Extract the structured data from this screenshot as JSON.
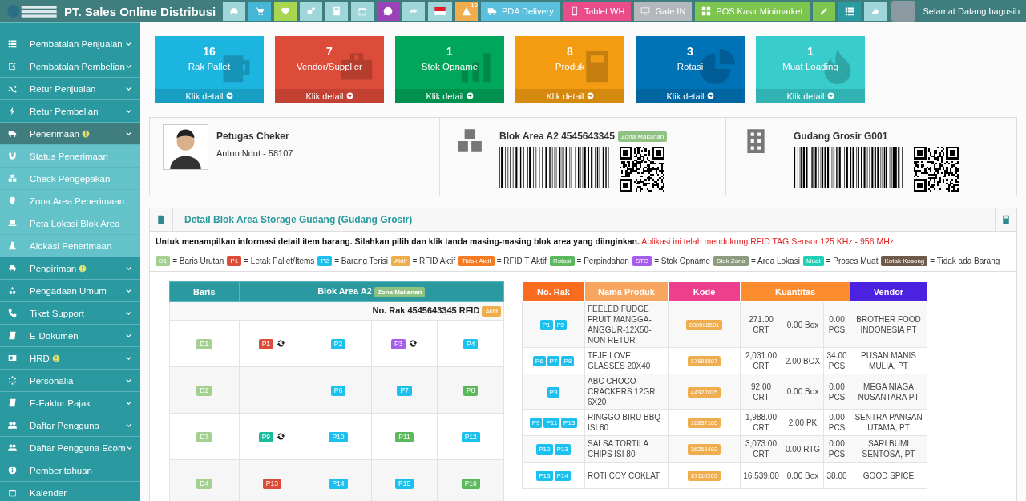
{
  "header": {
    "title": "PT. Sales Online Distribusi",
    "icon_buttons": [
      {
        "color": "#9fd6da"
      },
      {
        "color": "#45b6d6"
      },
      {
        "color": "#a9d651"
      },
      {
        "color": "#9fd6da"
      },
      {
        "color": "#9fd6da"
      },
      {
        "color": "#9fd6da"
      },
      {
        "color": "#9b42b8"
      },
      {
        "color": "#9fd6da"
      },
      {
        "color": "#9fd6da"
      },
      {
        "color": "#f0ad4e",
        "badge": "10"
      }
    ],
    "text_buttons": [
      {
        "label": "PDA Delivery",
        "color": "#5bc0de"
      },
      {
        "label": "Tablet WH",
        "color": "#ea4c89"
      },
      {
        "label": "Gate IN",
        "color": "#b3b8bc"
      },
      {
        "label": "POS Kasir Minimarket",
        "color": "#7cc54f"
      }
    ],
    "tool_buttons": [
      {
        "color": "#7cc54f"
      },
      {
        "color": "#2a9aa0"
      },
      {
        "color": "#9fd6da"
      }
    ],
    "greeting": "Selamat Datang bagusib"
  },
  "sidebar": {
    "items": [
      {
        "label": "Pembatalan Penjualan",
        "alert": false,
        "expandable": true,
        "selected": false
      },
      {
        "label": "Pembatalan Pembelian",
        "alert": false,
        "expandable": true,
        "selected": false
      },
      {
        "label": "Retur Penjualan",
        "alert": false,
        "expandable": true,
        "selected": false
      },
      {
        "label": "Retur Pembelian",
        "alert": false,
        "expandable": true,
        "selected": false
      },
      {
        "label": "Penerimaan",
        "alert": true,
        "expandable": true,
        "selected": true,
        "children": [
          {
            "label": "Status Penerimaan"
          },
          {
            "label": "Check Pengepakan"
          },
          {
            "label": "Zona Area Penerimaan"
          },
          {
            "label": "Peta Lokasi Blok Area"
          },
          {
            "label": "Alokasi Penerimaan"
          }
        ]
      },
      {
        "label": "Pengiriman",
        "alert": true,
        "expandable": true,
        "selected": false
      },
      {
        "label": "Pengadaan Umum",
        "alert": false,
        "expandable": true,
        "selected": false
      },
      {
        "label": "Tiket Support",
        "alert": false,
        "expandable": true,
        "selected": false
      },
      {
        "label": "E-Dokumen",
        "alert": false,
        "expandable": true,
        "selected": false
      },
      {
        "label": "HRD",
        "alert": true,
        "expandable": true,
        "selected": false
      },
      {
        "label": "Personalia",
        "alert": false,
        "expandable": true,
        "selected": false
      },
      {
        "label": "E-Faktur Pajak",
        "alert": false,
        "expandable": true,
        "selected": false
      },
      {
        "label": "Daftar Pengguna",
        "alert": false,
        "expandable": true,
        "selected": false
      },
      {
        "label": "Daftar Pengguna Ecom",
        "alert": false,
        "expandable": true,
        "selected": false
      },
      {
        "label": "Pemberitahuan",
        "alert": false,
        "expandable": false,
        "selected": false
      },
      {
        "label": "Kalender",
        "alert": false,
        "expandable": false,
        "selected": false
      }
    ]
  },
  "stat_cards": [
    {
      "value": "16",
      "label": "Rak Pallet",
      "link": "Klik detail",
      "color": "#1cb5e0"
    },
    {
      "value": "7",
      "label": "Vendor/Supplier",
      "link": "Klik detail",
      "color": "#dd4b39"
    },
    {
      "value": "1",
      "label": "Stok Opname",
      "link": "Klik detail",
      "color": "#00a65a"
    },
    {
      "value": "8",
      "label": "Produk",
      "link": "Klik detail",
      "color": "#f39c12"
    },
    {
      "value": "3",
      "label": "Rotasi",
      "link": "Klik detail",
      "color": "#0073b7"
    },
    {
      "value": "1",
      "label": "Muat Loading",
      "link": "Klik detail",
      "color": "#39cccc"
    }
  ],
  "info": {
    "officer": {
      "title": "Petugas Cheker",
      "name": "Anton Ndut - 58107"
    },
    "block": {
      "title": "Blok Area A2 4545643345",
      "zone": "Zona Makanan"
    },
    "warehouse": {
      "title": "Gudang Grosir G001"
    }
  },
  "detail": {
    "title": "Detail Blok Area Storage Gudang (Gudang Grosir)",
    "description": "**Untuk menampilkan informasi detail item barang. Silahkan pilih dan klik tanda masing-masing blok area yang diinginkan.**",
    "notice": "Aplikasi ini telah mendukung RFID TAG Sensor 125 KHz - 956 MHz.",
    "legend": [
      {
        "badge": "D1",
        "color": "#a3cf8f",
        "text": "= Baris Urutan"
      },
      {
        "badge": "P1",
        "color": "#dd4b39",
        "text": "= Letak Pallet/Items"
      },
      {
        "badge": "P2",
        "color": "#1cc0ef",
        "text": "= Barang Terisi"
      },
      {
        "badge": "Aktif",
        "color": "#f0ad4e",
        "text": "= RFID Aktif"
      },
      {
        "badge": "Tidak Aktif",
        "color": "#f57a22",
        "text": "= RFID T Aktif"
      },
      {
        "badge": "Rotasi",
        "color": "#5cb85c",
        "text": "= Perpindahan"
      },
      {
        "badge": "STO",
        "color": "#a55eea",
        "text": "= Stok Opname"
      },
      {
        "badge": "Blok Zona",
        "color": "#8d9b7f",
        "text": "= Area Lokasi"
      },
      {
        "badge": "Muat",
        "color": "#1fcfb6",
        "text": "= Proses Muat"
      },
      {
        "badge": "Kotak Kosong",
        "color": "#6e5a4a",
        "text": "= Tidak ada Barang"
      }
    ],
    "block_table": {
      "columns": [
        "Baris",
        "Blok Area A2"
      ],
      "zone": "Zona Makanan",
      "rack": "No. Rak 4545643345 RFID",
      "rfid": "Aktif",
      "rows": [
        {
          "row": {
            "label": "D1",
            "color": "#a3cf8f"
          },
          "pallets": [
            {
              "label": "P1",
              "color": "#dd4b39",
              "rotating": true
            },
            {
              "label": "P2",
              "color": "#1cc0ef",
              "rotating": false
            },
            {
              "label": "P3",
              "color": "#a55eea",
              "rotating": true
            },
            {
              "label": "P4",
              "color": "#1cc0ef",
              "rotating": false
            }
          ]
        },
        {
          "row": {
            "label": "D2",
            "color": "#a3cf8f"
          },
          "pallets": [
            {
              "empty": true
            },
            {
              "label": "P6",
              "color": "#1cc0ef",
              "rotating": false
            },
            {
              "label": "P7",
              "color": "#1cc0ef",
              "rotating": false
            },
            {
              "label": "P8",
              "color": "#5cb85c",
              "rotating": false
            }
          ]
        },
        {
          "row": {
            "label": "D3",
            "color": "#a3cf8f"
          },
          "pallets": [
            {
              "label": "P9",
              "color": "#1abc9c",
              "rotating": true
            },
            {
              "label": "P10",
              "color": "#1cc0ef",
              "rotating": false
            },
            {
              "label": "P11",
              "color": "#5cb85c",
              "rotating": false
            },
            {
              "label": "P12",
              "color": "#1cc0ef",
              "rotating": false
            }
          ]
        },
        {
          "row": {
            "label": "D4",
            "color": "#a3cf8f"
          },
          "pallets": [
            {
              "label": "P13",
              "color": "#dd4b39",
              "rotating": false
            },
            {
              "label": "P14",
              "color": "#1cc0ef",
              "rotating": false
            },
            {
              "label": "P15",
              "color": "#1cc0ef",
              "rotating": false
            },
            {
              "label": "P16",
              "color": "#5cb85c",
              "rotating": false
            }
          ]
        }
      ]
    },
    "product_table": {
      "columns": [
        {
          "label": "No. Rak",
          "color": "#fb6c1f"
        },
        {
          "label": "Nama Produk",
          "color": "#f8a55f"
        },
        {
          "label": "Kode",
          "color": "#ee3f8f"
        },
        {
          "label": "Kuantitas",
          "color": "#fc8c2e"
        },
        {
          "label": "Vendor",
          "color": "#4a22e0"
        }
      ],
      "rows": [
        {
          "racks": [
            "P1",
            "P2"
          ],
          "product": "FEELED FUDGE FRUIT MANGGA-ANGGUR-12X50-NON RETUR",
          "code": "000598501",
          "qty_1": "271.00 CRT",
          "qty_2": "0.00 Box",
          "qty_3": "0.00 PCS",
          "vendor": "BROTHER FOOD INDONESIA PT"
        },
        {
          "racks": [
            "P6",
            "P7",
            "P8"
          ],
          "product": "TEJE LOVE GLASSES 20X40",
          "code": "17893507",
          "qty_1": "2,031.00 CRT",
          "qty_2": "2.00 BOX",
          "qty_3": "34.00 PCS",
          "vendor": "PUSAN MANIS MULIA, PT"
        },
        {
          "racks": [
            "P3"
          ],
          "product": "ABC CHOCO CRACKERS 12GR 6X20",
          "code": "44922025",
          "qty_1": "92.00 CRT",
          "qty_2": "0.00 Box",
          "qty_3": "0.00 PCS",
          "vendor": "MEGA NIAGA NUSANTARA PT"
        },
        {
          "racks": [
            "P9",
            "P11",
            "P13"
          ],
          "product": "RINGGO BIRU BBQ ISI 80",
          "code": "16837105",
          "qty_1": "1,988.00 CRT",
          "qty_2": "2.00 PK",
          "qty_3": "0.00 PCS",
          "vendor": "SENTRA PANGAN UTAMA, PT"
        },
        {
          "racks": [
            "P12",
            "P13"
          ],
          "product": "SALSA TORTILA CHIPS ISI 80",
          "code": "36269402",
          "qty_1": "3,073.00 CRT",
          "qty_2": "0.00 RTG",
          "qty_3": "0.00 PCS",
          "vendor": "SARI BUMI SENTOSA, PT"
        },
        {
          "racks": [
            "P13",
            "P14"
          ],
          "product": "ROTI COY COKLAT",
          "code": "87110205",
          "qty_1": "16,539.00",
          "qty_2": "0.00 Box",
          "qty_3": "38.00",
          "vendor": "GOOD SPICE"
        }
      ]
    }
  }
}
